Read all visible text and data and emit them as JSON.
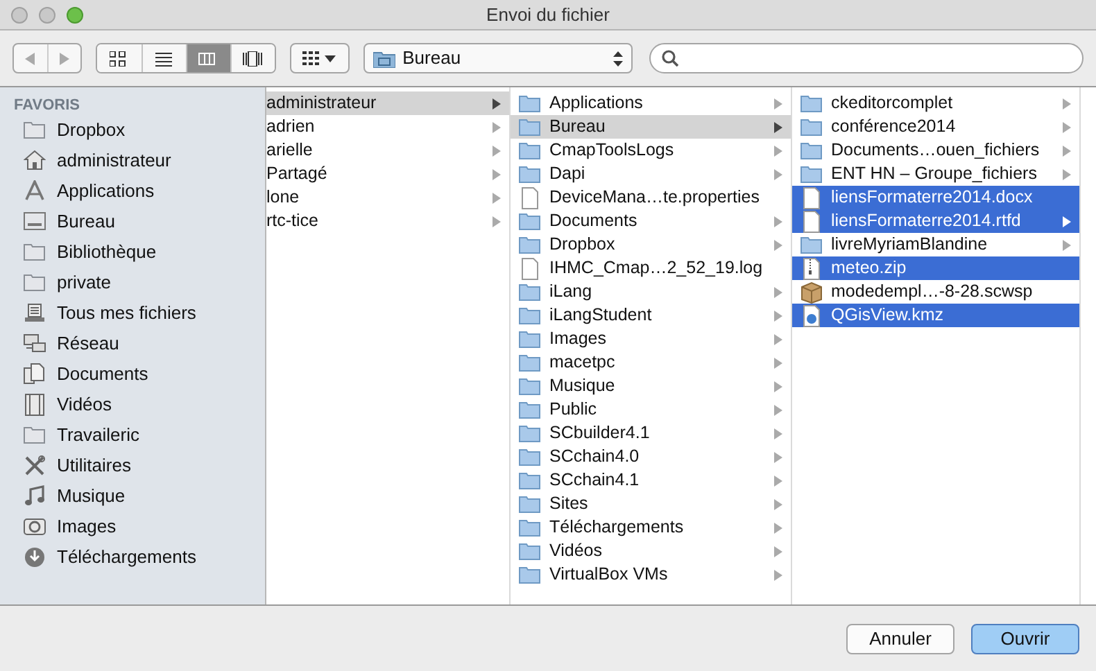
{
  "window": {
    "title": "Envoi du fichier"
  },
  "toolbar": {
    "view_modes": [
      {
        "kind": "icons",
        "selected": false
      },
      {
        "kind": "list",
        "selected": false
      },
      {
        "kind": "columns",
        "selected": true
      },
      {
        "kind": "coverflow",
        "selected": false
      }
    ],
    "location": "Bureau"
  },
  "sidebar": {
    "heading": "FAVORIS",
    "items": [
      {
        "label": "Dropbox",
        "kind": "folder"
      },
      {
        "label": "administrateur",
        "kind": "home"
      },
      {
        "label": "Applications",
        "kind": "apps"
      },
      {
        "label": "Bureau",
        "kind": "desktop"
      },
      {
        "label": "Bibliothèque",
        "kind": "folder"
      },
      {
        "label": "private",
        "kind": "folder"
      },
      {
        "label": "Tous mes fichiers",
        "kind": "allfiles"
      },
      {
        "label": "Réseau",
        "kind": "network"
      },
      {
        "label": "Documents",
        "kind": "documents"
      },
      {
        "label": "Vidéos",
        "kind": "film"
      },
      {
        "label": "Travaileric",
        "kind": "folder"
      },
      {
        "label": "Utilitaires",
        "kind": "tools"
      },
      {
        "label": "Musique",
        "kind": "music"
      },
      {
        "label": "Images",
        "kind": "camera"
      },
      {
        "label": "Téléchargements",
        "kind": "download"
      }
    ]
  },
  "columns": [
    {
      "items": [
        {
          "name": "administrateur",
          "kind": "none",
          "has_children": true,
          "selected": true
        },
        {
          "name": "adrien",
          "kind": "none",
          "has_children": true,
          "selected": false
        },
        {
          "name": "arielle",
          "kind": "none",
          "has_children": true,
          "selected": false
        },
        {
          "name": "Partagé",
          "kind": "none",
          "has_children": true,
          "selected": false
        },
        {
          "name": "lone",
          "kind": "none",
          "has_children": true,
          "selected": false
        },
        {
          "name": "rtc-tice",
          "kind": "none",
          "has_children": true,
          "selected": false
        }
      ]
    },
    {
      "items": [
        {
          "name": "Applications",
          "kind": "folder",
          "has_children": true,
          "selected": false
        },
        {
          "name": "Bureau",
          "kind": "folder",
          "has_children": true,
          "selected": true
        },
        {
          "name": "CmapToolsLogs",
          "kind": "folder",
          "has_children": true,
          "selected": false
        },
        {
          "name": "Dapi",
          "kind": "folder",
          "has_children": true,
          "selected": false
        },
        {
          "name": "DeviceMana…te.properties",
          "kind": "document",
          "has_children": false,
          "selected": false
        },
        {
          "name": "Documents",
          "kind": "folder",
          "has_children": true,
          "selected": false
        },
        {
          "name": "Dropbox",
          "kind": "folder",
          "has_children": true,
          "selected": false
        },
        {
          "name": "IHMC_Cmap…2_52_19.log",
          "kind": "document",
          "has_children": false,
          "selected": false
        },
        {
          "name": "iLang",
          "kind": "folder",
          "has_children": true,
          "selected": false
        },
        {
          "name": "iLangStudent",
          "kind": "folder",
          "has_children": true,
          "selected": false
        },
        {
          "name": "Images",
          "kind": "folder",
          "has_children": true,
          "selected": false
        },
        {
          "name": "macetpc",
          "kind": "folder",
          "has_children": true,
          "selected": false
        },
        {
          "name": "Musique",
          "kind": "folder",
          "has_children": true,
          "selected": false
        },
        {
          "name": "Public",
          "kind": "folder",
          "has_children": true,
          "selected": false
        },
        {
          "name": "SCbuilder4.1",
          "kind": "folder",
          "has_children": true,
          "selected": false
        },
        {
          "name": "SCchain4.0",
          "kind": "folder",
          "has_children": true,
          "selected": false
        },
        {
          "name": "SCchain4.1",
          "kind": "folder",
          "has_children": true,
          "selected": false
        },
        {
          "name": "Sites",
          "kind": "folder",
          "has_children": true,
          "selected": false
        },
        {
          "name": "Téléchargements",
          "kind": "folder",
          "has_children": true,
          "selected": false
        },
        {
          "name": "Vidéos",
          "kind": "folder",
          "has_children": true,
          "selected": false
        },
        {
          "name": "VirtualBox VMs",
          "kind": "folder",
          "has_children": true,
          "selected": false
        }
      ]
    },
    {
      "items": [
        {
          "name": "ckeditorcomplet",
          "kind": "folder",
          "has_children": true,
          "selected": false
        },
        {
          "name": "conférence2014",
          "kind": "folder",
          "has_children": true,
          "selected": false
        },
        {
          "name": "Documents…ouen_fichiers",
          "kind": "folder",
          "has_children": true,
          "selected": false
        },
        {
          "name": "ENT HN – Groupe_fichiers",
          "kind": "folder",
          "has_children": true,
          "selected": false
        },
        {
          "name": "liensFormaterre2014.docx",
          "kind": "document",
          "has_children": false,
          "selected": true
        },
        {
          "name": "liensFormaterre2014.rtfd",
          "kind": "document",
          "has_children": true,
          "selected": true
        },
        {
          "name": "livreMyriamBlandine",
          "kind": "folder",
          "has_children": true,
          "selected": false
        },
        {
          "name": "meteo.zip",
          "kind": "archive",
          "has_children": false,
          "selected": true
        },
        {
          "name": "modedempl…-8-28.scwsp",
          "kind": "package",
          "has_children": false,
          "selected": false
        },
        {
          "name": "QGisView.kmz",
          "kind": "map",
          "has_children": false,
          "selected": true
        }
      ]
    }
  ],
  "buttons": [
    {
      "label": "Annuler",
      "kind": "cancel"
    },
    {
      "label": "Ouvrir",
      "kind": "default"
    }
  ]
}
